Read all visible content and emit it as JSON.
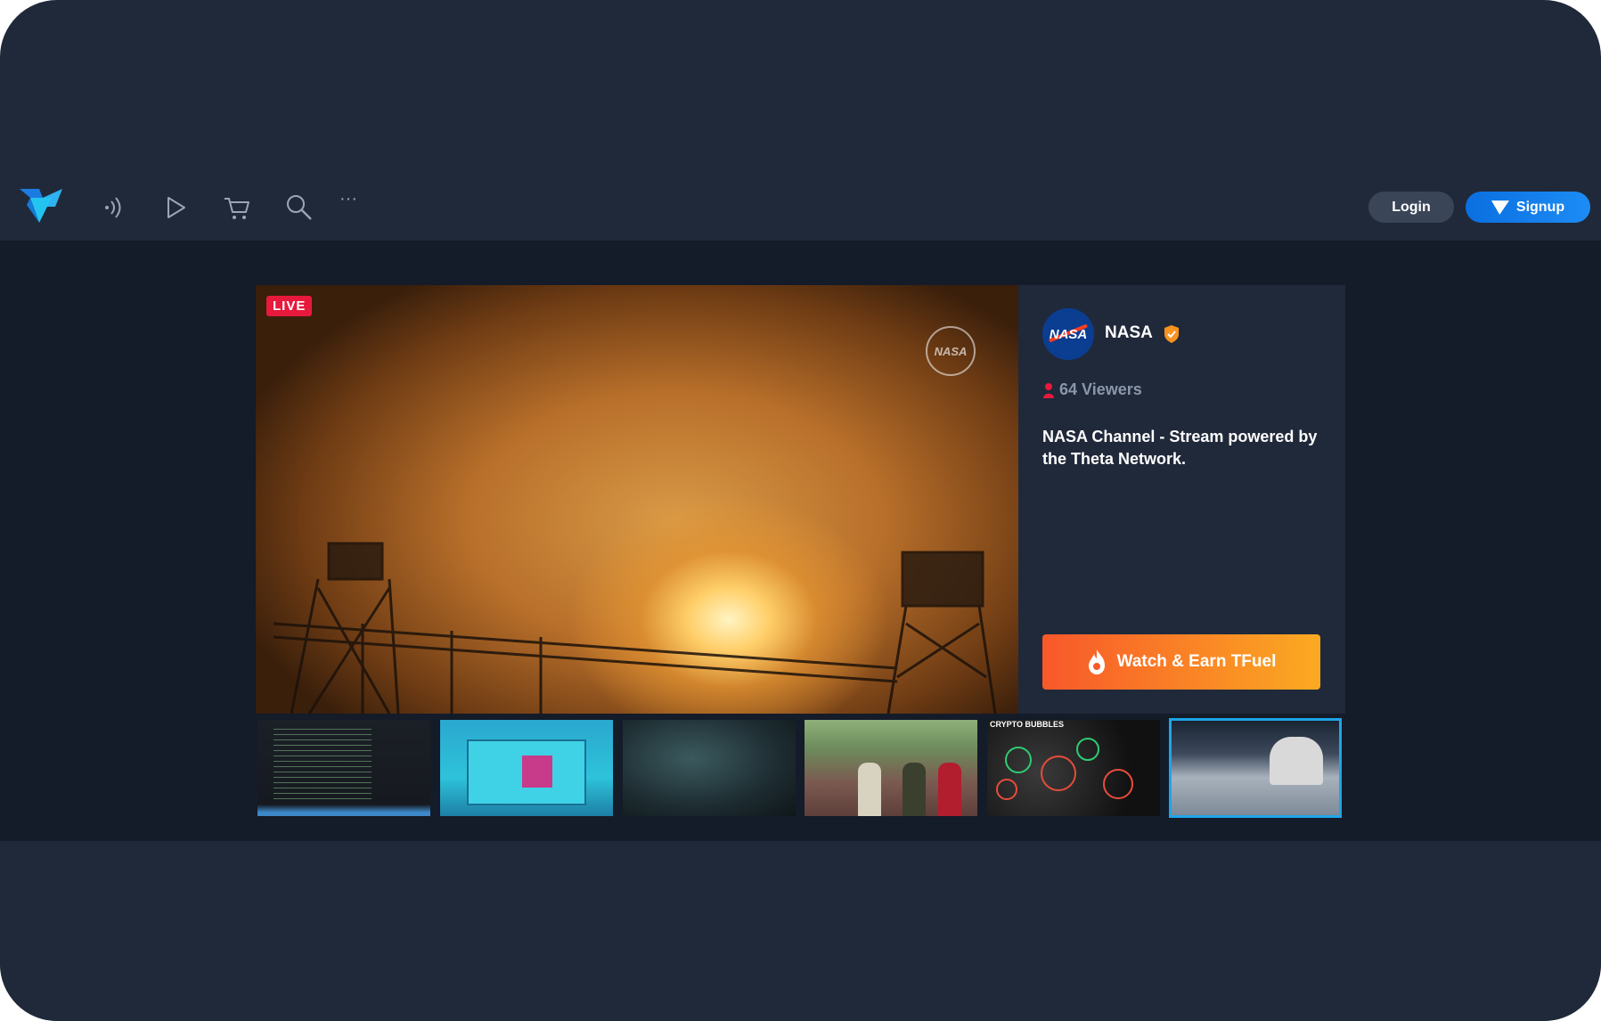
{
  "navbar": {
    "logo_icon": "theta-logo-icon",
    "icons": [
      "live-broadcast-icon",
      "play-icon",
      "cart-icon",
      "search-icon",
      "more-icon"
    ],
    "more_label": "···",
    "login_label": "Login",
    "signup_label": "Signup"
  },
  "stream": {
    "live_label": "LIVE",
    "watermark": "NASA"
  },
  "channel": {
    "avatar_text": "NASA",
    "name": "NASA",
    "verified": true,
    "viewers": "64 Viewers",
    "description": "NASA Channel - Stream powered by the Theta Network.",
    "earn_button_label": "Watch & Earn TFuel"
  },
  "thumbnails": [
    {
      "id": "code-stream"
    },
    {
      "id": "game-menu"
    },
    {
      "id": "dark-room"
    },
    {
      "id": "street-scene"
    },
    {
      "id": "crypto-bubbles",
      "caption": "CRYPTO BUBBLES"
    },
    {
      "id": "moon-lander",
      "selected": true
    }
  ],
  "colors": {
    "background": "#20293a",
    "content_background": "#141b29",
    "live_red": "#e8193c",
    "signup_blue": "#1d8cf5",
    "earn_orange_start": "#f8582a",
    "earn_orange_end": "#fbaa22",
    "selected_border": "#1fa5e8"
  }
}
